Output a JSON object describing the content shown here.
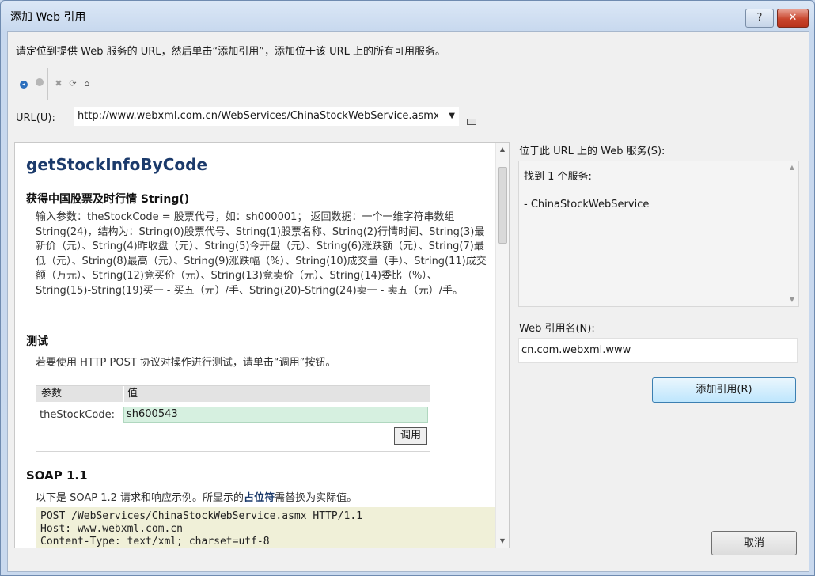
{
  "window": {
    "title": "添加 Web 引用",
    "help_label": "?",
    "close_label": "✕"
  },
  "instruction": "请定位到提供 Web 服务的 URL，然后单击“添加引用”，添加位于该 URL 上的所有可用服务。",
  "toolbar": {
    "icons": [
      "back-icon",
      "forward-icon",
      "stop-icon",
      "refresh-icon",
      "home-icon"
    ],
    "back_glyph": "◂",
    "stop_glyph": "✖",
    "refresh_glyph": "⟳",
    "home_glyph": "⌂"
  },
  "url": {
    "label": "URL(U):",
    "value": "http://www.webxml.com.cn/WebServices/ChinaStockWebService.asmx",
    "dropdown_glyph": "▼"
  },
  "browser": {
    "operation_name": "getStockInfoByCode",
    "operation_subtitle": "获得中国股票及时行情 String()",
    "description": "输入参数：theStockCode = 股票代号，如：sh000001；  返回数据：一个一维字符串数组 String(24)，结构为：String(0)股票代号、String(1)股票名称、String(2)行情时间、String(3)最新价（元）、String(4)昨收盘（元）、String(5)今开盘（元）、String(6)涨跌额（元）、String(7)最低（元）、String(8)最高（元）、String(9)涨跌幅（%）、String(10)成交量（手）、String(11)成交额（万元）、String(12)竞买价（元）、String(13)竞卖价（元）、String(14)委比（%）、String(15)-String(19)买一 - 买五（元）/手、String(20)-String(24)卖一 - 卖五（元）/手。",
    "test": {
      "heading": "测试",
      "description": "若要使用 HTTP POST 协议对操作进行测试，请单击“调用”按钮。",
      "col_param": "参数",
      "col_value": "值",
      "param_name": "theStockCode:",
      "param_value": "sh600543",
      "invoke_label": "调用"
    },
    "soap": {
      "heading": "SOAP 1.1",
      "desc_before": "以下是 SOAP 1.2 请求和响应示例。所显示的",
      "desc_placeholder": "占位符",
      "desc_after": "需替换为实际值。",
      "code_lines": [
        "POST /WebServices/ChinaStockWebService.asmx HTTP/1.1",
        "Host: www.webxml.com.cn",
        "Content-Type: text/xml; charset=utf-8"
      ]
    },
    "scroll_up": "▲",
    "scroll_down": "▼"
  },
  "services": {
    "label": "位于此 URL 上的 Web 服务(S):",
    "found": "找到 1 个服务:",
    "items": [
      "- ChinaStockWebService"
    ]
  },
  "reference": {
    "label": "Web 引用名(N):",
    "value": "cn.com.webxml.www"
  },
  "buttons": {
    "add": "添加引用(R)",
    "cancel": "取消"
  }
}
